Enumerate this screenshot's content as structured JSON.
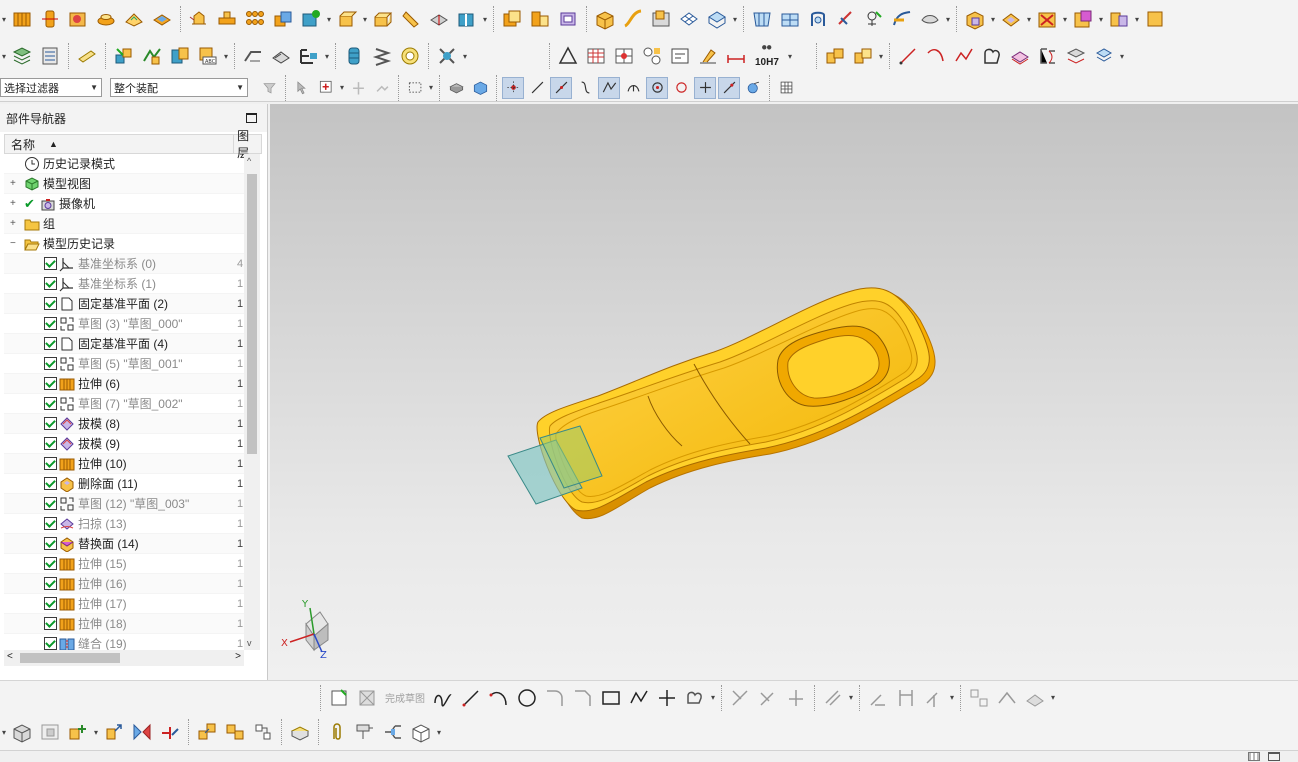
{
  "filters": {
    "selection_filter": "选择过滤器",
    "assembly_scope": "整个装配"
  },
  "navigator": {
    "title": "部件导航器",
    "col_name": "名称",
    "col_layer": "图层",
    "items": [
      {
        "label": "历史记录模式",
        "col2": "",
        "dim": false,
        "level": 0,
        "expand": "",
        "check": false,
        "icon": "clock-icon"
      },
      {
        "label": "模型视图",
        "col2": "",
        "dim": false,
        "level": 0,
        "expand": "+",
        "check": false,
        "icon": "model-views-icon"
      },
      {
        "label": "摄像机",
        "col2": "",
        "dim": false,
        "level": 0,
        "expand": "+",
        "check": true,
        "icon": "camera-icon"
      },
      {
        "label": "组",
        "col2": "",
        "dim": false,
        "level": 0,
        "expand": "+",
        "check": false,
        "icon": "folder-icon"
      },
      {
        "label": "模型历史记录",
        "col2": "",
        "dim": false,
        "level": 0,
        "expand": "−",
        "check": false,
        "icon": "folder-open-icon"
      },
      {
        "label": "基准坐标系 (0)",
        "col2": "4",
        "dim": true,
        "level": 1,
        "expand": "",
        "check": true,
        "icon": "datum-csys-icon"
      },
      {
        "label": "基准坐标系 (1)",
        "col2": "1",
        "dim": true,
        "level": 1,
        "expand": "",
        "check": true,
        "icon": "datum-csys-icon"
      },
      {
        "label": "固定基准平面 (2)",
        "col2": "1",
        "dim": false,
        "level": 1,
        "expand": "",
        "check": true,
        "icon": "datum-plane-icon"
      },
      {
        "label": "草图 (3) \"草图_000\"",
        "col2": "1",
        "dim": true,
        "level": 1,
        "expand": "",
        "check": true,
        "icon": "sketch-icon"
      },
      {
        "label": "固定基准平面 (4)",
        "col2": "1",
        "dim": false,
        "level": 1,
        "expand": "",
        "check": true,
        "icon": "datum-plane-icon"
      },
      {
        "label": "草图 (5) \"草图_001\"",
        "col2": "1",
        "dim": true,
        "level": 1,
        "expand": "",
        "check": true,
        "icon": "sketch-icon"
      },
      {
        "label": "拉伸 (6)",
        "col2": "1",
        "dim": false,
        "level": 1,
        "expand": "",
        "check": true,
        "icon": "extrude-icon"
      },
      {
        "label": "草图 (7) \"草图_002\"",
        "col2": "1",
        "dim": true,
        "level": 1,
        "expand": "",
        "check": true,
        "icon": "sketch-icon"
      },
      {
        "label": "拔模 (8)",
        "col2": "1",
        "dim": false,
        "level": 1,
        "expand": "",
        "check": true,
        "icon": "draft-icon"
      },
      {
        "label": "拔模 (9)",
        "col2": "1",
        "dim": false,
        "level": 1,
        "expand": "",
        "check": true,
        "icon": "draft-icon"
      },
      {
        "label": "拉伸 (10)",
        "col2": "1",
        "dim": false,
        "level": 1,
        "expand": "",
        "check": true,
        "icon": "extrude-icon"
      },
      {
        "label": "删除面 (11)",
        "col2": "1",
        "dim": false,
        "level": 1,
        "expand": "",
        "check": true,
        "icon": "delete-face-icon"
      },
      {
        "label": "草图 (12) \"草图_003\"",
        "col2": "1",
        "dim": true,
        "level": 1,
        "expand": "",
        "check": true,
        "icon": "sketch-icon"
      },
      {
        "label": "扫掠 (13)",
        "col2": "1",
        "dim": true,
        "level": 1,
        "expand": "",
        "check": true,
        "icon": "swept-icon"
      },
      {
        "label": "替换面 (14)",
        "col2": "1",
        "dim": false,
        "level": 1,
        "expand": "",
        "check": true,
        "icon": "replace-face-icon"
      },
      {
        "label": "拉伸 (15)",
        "col2": "1",
        "dim": true,
        "level": 1,
        "expand": "",
        "check": true,
        "icon": "extrude-icon"
      },
      {
        "label": "拉伸 (16)",
        "col2": "1",
        "dim": true,
        "level": 1,
        "expand": "",
        "check": true,
        "icon": "extrude-icon"
      },
      {
        "label": "拉伸 (17)",
        "col2": "1",
        "dim": true,
        "level": 1,
        "expand": "",
        "check": true,
        "icon": "extrude-icon"
      },
      {
        "label": "拉伸 (18)",
        "col2": "1",
        "dim": true,
        "level": 1,
        "expand": "",
        "check": true,
        "icon": "extrude-icon"
      },
      {
        "label": "缝合 (19)",
        "col2": "1",
        "dim": true,
        "level": 1,
        "expand": "",
        "check": true,
        "icon": "sew-icon"
      }
    ]
  },
  "sketch_toolbar": {
    "finish_sketch": "完成草图"
  },
  "fit_label": "10H7",
  "triad": {
    "x": "X",
    "y": "Y",
    "z": "Z"
  },
  "colors": {
    "part_body": "#f7c11a",
    "part_edge": "#c98900",
    "datum_plane": "#7fc6c3",
    "viewport_top": "#c3c3c3",
    "viewport_bottom": "#f0f0f0"
  }
}
